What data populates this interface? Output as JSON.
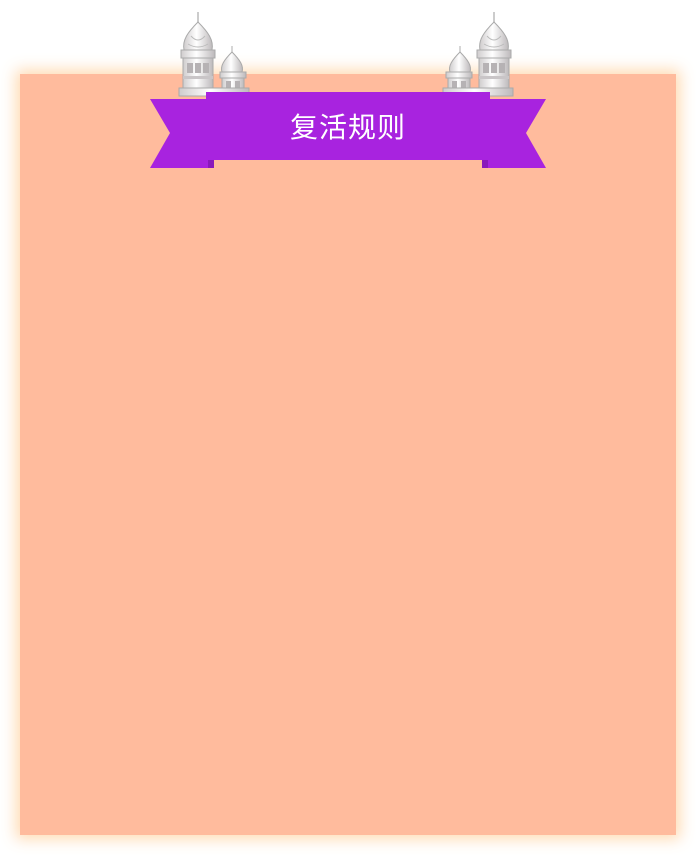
{
  "title": "复活规则",
  "colors": {
    "panel_bg": "#ffbb9d",
    "panel_glow": "#ffd6aa",
    "ribbon": "#a823df",
    "ribbon_fold": "#8a19bb",
    "tower": "#e9e7e8"
  },
  "icons": {
    "left_decoration": "onion-dome-tower-icon",
    "right_decoration": "onion-dome-tower-icon"
  }
}
